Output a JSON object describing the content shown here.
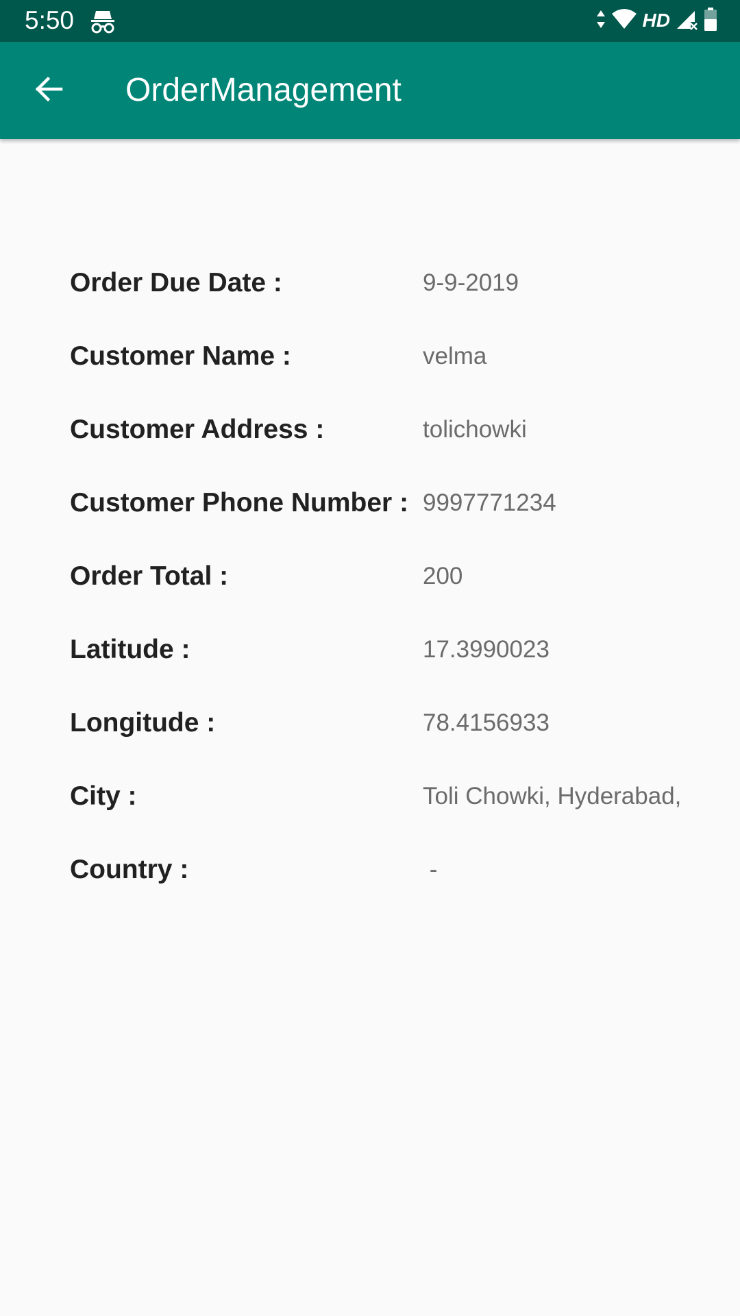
{
  "status_bar": {
    "time": "5:50",
    "network_label": "HD",
    "icons": [
      "incognito-icon",
      "data-arrows-icon",
      "wifi-icon",
      "signal-icon",
      "battery-icon"
    ]
  },
  "app_bar": {
    "title": "OrderManagement",
    "back_icon": "arrow-back-icon"
  },
  "colors": {
    "status_bar": "#00574b",
    "app_bar": "#008577",
    "background": "#fafafa",
    "label_text": "#212121",
    "value_text": "#6b6b6b"
  },
  "details": [
    {
      "label": "Order Due Date :",
      "value": "9-9-2019"
    },
    {
      "label": "Customer Name :",
      "value": "velma"
    },
    {
      "label": "Customer Address :",
      "value": "tolichowki"
    },
    {
      "label": "Customer Phone Number :",
      "value": "9997771234"
    },
    {
      "label": "Order Total :",
      "value": "200"
    },
    {
      "label": "Latitude :",
      "value": "17.3990023"
    },
    {
      "label": "Longitude :",
      "value": "78.4156933"
    },
    {
      "label": "City :",
      "value": "Toli Chowki, Hyderabad,"
    },
    {
      "label": "Country :",
      "value": " -"
    }
  ]
}
